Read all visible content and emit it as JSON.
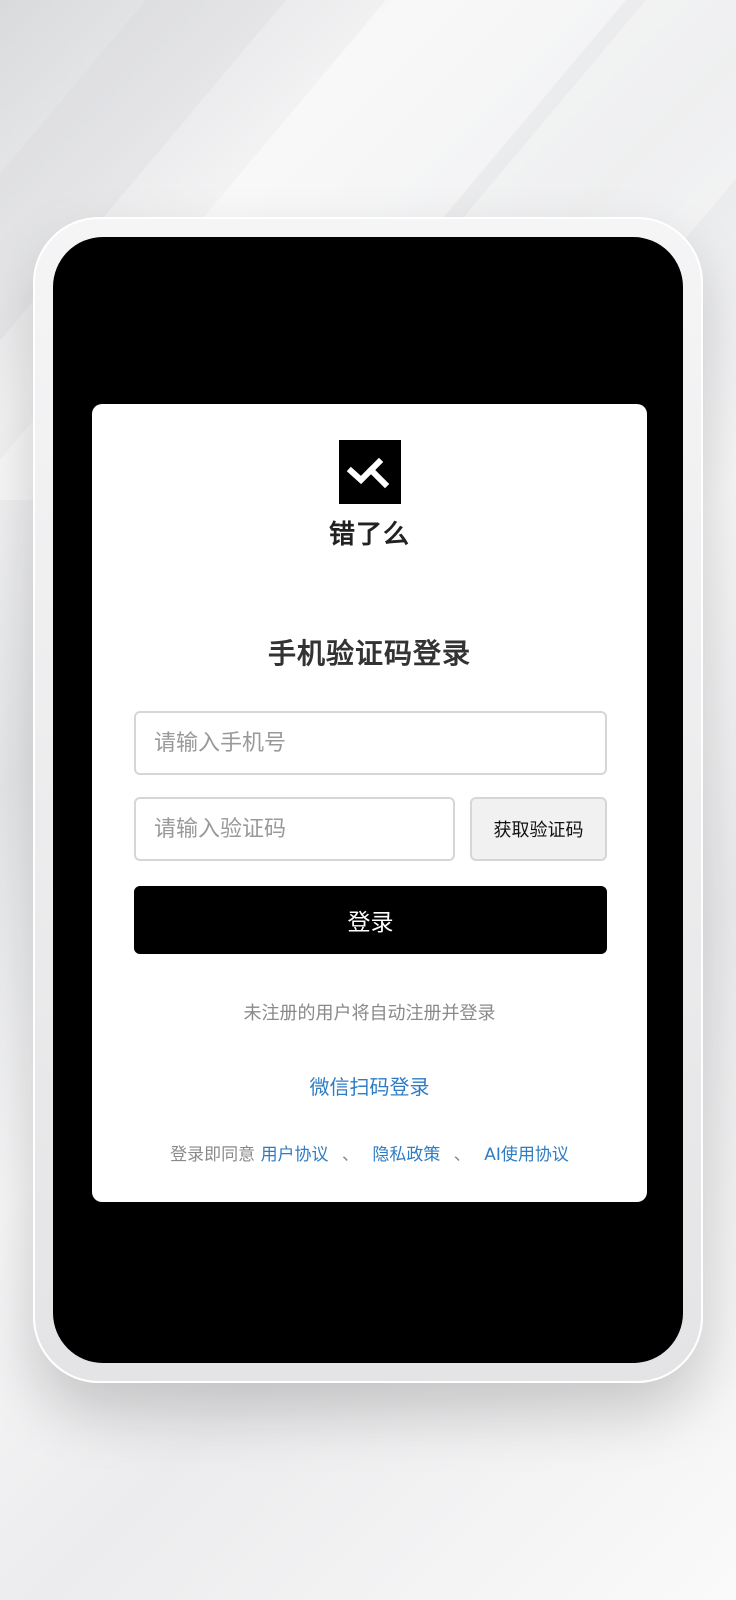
{
  "app": {
    "name": "错了么"
  },
  "login": {
    "title": "手机验证码登录",
    "phone_placeholder": "请输入手机号",
    "code_placeholder": "请输入验证码",
    "get_code_label": "获取验证码",
    "submit_label": "登录",
    "auto_register_note": "未注册的用户将自动注册并登录",
    "wechat_login_label": "微信扫码登录"
  },
  "agreement": {
    "prefix": "登录即同意",
    "separator": "、",
    "links": [
      {
        "label": "用户协议"
      },
      {
        "label": "隐私政策"
      },
      {
        "label": "AI使用协议"
      }
    ]
  },
  "colors": {
    "accent_black": "#000000",
    "link_blue": "#2f7cc4",
    "muted_text": "#8a8a8c"
  },
  "icons": {
    "logo": "check-x-logo-icon"
  }
}
